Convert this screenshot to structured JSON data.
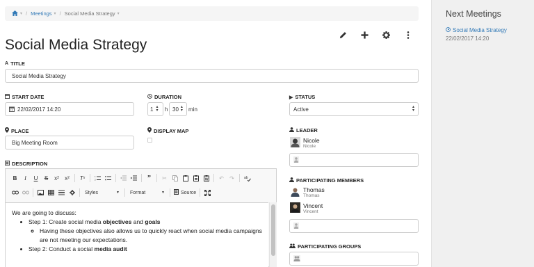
{
  "breadcrumb": {
    "home_icon": "home-icon",
    "meetings": "Meetings",
    "current": "Social Media Strategy"
  },
  "toolbar": {
    "icons": [
      "pencil-icon",
      "plus-icon",
      "gear-icon",
      "more-vertical-icon"
    ]
  },
  "page_title": "Social Media Strategy",
  "form": {
    "title_label": "TITLE",
    "title_value": "Social Media Strategy",
    "start_date_label": "START DATE",
    "start_date_value": "22/02/2017 14:20",
    "duration_label": "DURATION",
    "duration_hours": "1",
    "duration_hours_unit": "h",
    "duration_minutes": "30",
    "duration_minutes_unit": "min",
    "status_label": "STATUS",
    "status_value": "Active",
    "place_label": "PLACE",
    "place_value": "Big Meeting Room",
    "display_map_label": "DISPLAY MAP",
    "display_map_checked": false,
    "leader_label": "LEADER",
    "leader": {
      "name": "Nicole",
      "sub": "Nicole"
    },
    "participating_members_label": "PARTICIPATING MEMBERS",
    "members": [
      {
        "name": "Thomas",
        "sub": "Thomas"
      },
      {
        "name": "Vincent",
        "sub": "Vincent"
      }
    ],
    "participating_groups_label": "PARTICIPATING GROUPS",
    "description_label": "DESCRIPTION"
  },
  "editor": {
    "styles_label": "Styles",
    "format_label": "Format",
    "source_label": "Source",
    "content": {
      "intro": "We are going to discuss:",
      "step1_prefix": "Step 1: Create social media ",
      "step1_bold1": "objectives",
      "step1_mid": " and ",
      "step1_bold2": "goals",
      "step1_sub": "Having these objectives also allows us to quickly react when social media campaigns are not meeting our expectations.",
      "step2_prefix": "Step 2: Conduct a social ",
      "step2_bold": "media audit"
    }
  },
  "sidebar": {
    "title": "Next Meetings",
    "meeting_link": "Social Media Strategy",
    "meeting_date": "22/02/2017 14:20"
  },
  "colors": {
    "link": "#337ab7",
    "sidebar_bg": "#f0f0f0"
  }
}
